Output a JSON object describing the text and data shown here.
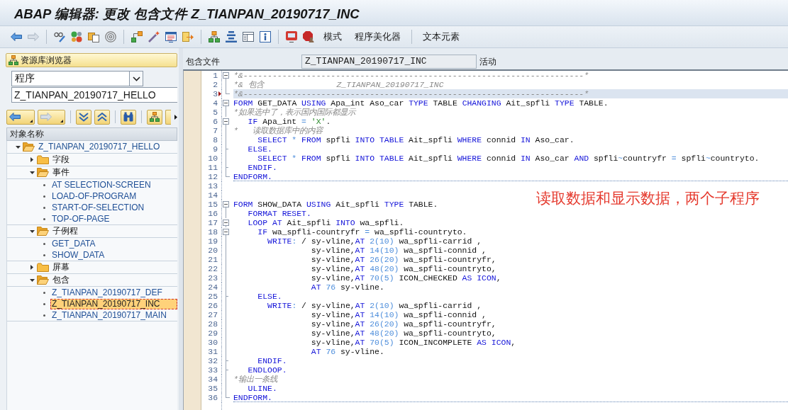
{
  "window": {
    "title": "ABAP 编辑器: 更改 包含文件 Z_TIANPAN_20190717_INC"
  },
  "toolbar": {
    "back_disabled": false,
    "forward_disabled": true,
    "text_button_groups": [
      [
        "模式",
        "程序美化器"
      ],
      [
        "文本元素"
      ]
    ]
  },
  "repository_browser": {
    "title": "资源库浏览器",
    "object_type": "程序",
    "object_name": "Z_TIANPAN_20190717_HELLO",
    "back_disabled": false,
    "forward_disabled": true,
    "tree": {
      "header": "对象名称",
      "items": [
        {
          "label": "Z_TIANPAN_20190717_HELLO",
          "kind": "program",
          "expanded": true,
          "selected": false,
          "children": [
            {
              "label": "字段",
              "kind": "folder",
              "expanded": false,
              "selected": false
            },
            {
              "label": "事件",
              "kind": "folder",
              "expanded": true,
              "selected": false,
              "children": [
                {
                  "label": "AT SELECTION-SCREEN",
                  "kind": "leaf",
                  "selected": false
                },
                {
                  "label": "LOAD-OF-PROGRAM",
                  "kind": "leaf",
                  "selected": false
                },
                {
                  "label": "START-OF-SELECTION",
                  "kind": "leaf",
                  "selected": false
                },
                {
                  "label": "TOP-OF-PAGE",
                  "kind": "leaf",
                  "selected": false
                }
              ]
            },
            {
              "label": "子例程",
              "kind": "folder",
              "expanded": true,
              "selected": false,
              "children": [
                {
                  "label": "GET_DATA",
                  "kind": "leaf",
                  "selected": false
                },
                {
                  "label": "SHOW_DATA",
                  "kind": "leaf",
                  "selected": false
                }
              ]
            },
            {
              "label": "屏幕",
              "kind": "folder",
              "expanded": false,
              "selected": false
            },
            {
              "label": "包含",
              "kind": "folder",
              "expanded": true,
              "selected": false,
              "children": [
                {
                  "label": "Z_TIANPAN_20190717_DEF",
                  "kind": "leaf",
                  "selected": false
                },
                {
                  "label": "Z_TIANPAN_20190717_INC",
                  "kind": "leaf",
                  "selected": true
                },
                {
                  "label": "Z_TIANPAN_20190717_MAIN",
                  "kind": "leaf",
                  "selected": false
                }
              ]
            }
          ]
        }
      ]
    }
  },
  "include_bar": {
    "label": "包含文件",
    "value": "Z_TIANPAN_20190717_INC",
    "status": "活动"
  },
  "code": {
    "lines": [
      {
        "number": "1",
        "kind": "start",
        "current": false,
        "divider_below": false,
        "tokens": [
          {
            "text": "*&----------------------------------------------------------------------*",
            "kind": "comment"
          }
        ]
      },
      {
        "number": "2",
        "kind": "bar",
        "current": false,
        "divider_below": false,
        "tokens": [
          {
            "text": "*& 包含               Z_TIANPAN_20190717_INC",
            "kind": "comment"
          }
        ]
      },
      {
        "number": "3",
        "kind": "end",
        "current": true,
        "divider_below": false,
        "tokens": [
          {
            "text": "*&----------------------------------------------------------------------*",
            "kind": "comment"
          }
        ]
      },
      {
        "number": "4",
        "kind": "start",
        "current": false,
        "divider_below": false,
        "tokens": [
          {
            "text": "FORM",
            "kind": "keyword"
          },
          {
            "text": " GET_DATA ",
            "kind": "text"
          },
          {
            "text": "USING",
            "kind": "keyword"
          },
          {
            "text": " Apa_int Aso_car ",
            "kind": "text"
          },
          {
            "text": "TYPE",
            "kind": "keyword"
          },
          {
            "text": " TABLE ",
            "kind": "text"
          },
          {
            "text": "CHANGING",
            "kind": "keyword"
          },
          {
            "text": " Ait_spfli ",
            "kind": "text"
          },
          {
            "text": "TYPE",
            "kind": "keyword"
          },
          {
            "text": " TABLE.",
            "kind": "text"
          }
        ]
      },
      {
        "number": "5",
        "kind": "bar",
        "current": false,
        "divider_below": false,
        "tokens": [
          {
            "text": "*如果选中了，表示国内国际都显示",
            "kind": "comment"
          }
        ]
      },
      {
        "number": "6",
        "kind": "start",
        "current": false,
        "divider_below": false,
        "tokens": [
          {
            "text": "   IF",
            "kind": "keyword"
          },
          {
            "text": " Apa_int ",
            "kind": "text"
          },
          {
            "text": "=",
            "kind": "operator"
          },
          {
            "text": " 'X'",
            "kind": "string"
          },
          {
            "text": ".",
            "kind": "text"
          }
        ]
      },
      {
        "number": "7",
        "kind": "bar",
        "current": false,
        "divider_below": false,
        "tokens": [
          {
            "text": "*   读取数据库中的内容",
            "kind": "comment"
          }
        ]
      },
      {
        "number": "8",
        "kind": "bar",
        "current": false,
        "divider_below": false,
        "tokens": [
          {
            "text": "     SELECT",
            "kind": "keyword"
          },
          {
            "text": " * ",
            "kind": "operator"
          },
          {
            "text": "FROM",
            "kind": "keyword"
          },
          {
            "text": " spfli ",
            "kind": "text"
          },
          {
            "text": "INTO TABLE",
            "kind": "keyword"
          },
          {
            "text": " Ait_spfli ",
            "kind": "text"
          },
          {
            "text": "WHERE",
            "kind": "keyword"
          },
          {
            "text": " connid ",
            "kind": "text"
          },
          {
            "text": "IN",
            "kind": "keyword"
          },
          {
            "text": " Aso_car.",
            "kind": "text"
          }
        ]
      },
      {
        "number": "9",
        "kind": "branch",
        "current": false,
        "divider_below": false,
        "tokens": [
          {
            "text": "   ELSE.",
            "kind": "keyword"
          }
        ]
      },
      {
        "number": "10",
        "kind": "bar",
        "current": false,
        "divider_below": false,
        "tokens": [
          {
            "text": "     SELECT",
            "kind": "keyword"
          },
          {
            "text": " * ",
            "kind": "operator"
          },
          {
            "text": "FROM",
            "kind": "keyword"
          },
          {
            "text": " spfli ",
            "kind": "text"
          },
          {
            "text": "INTO TABLE",
            "kind": "keyword"
          },
          {
            "text": " Ait_spfli ",
            "kind": "text"
          },
          {
            "text": "WHERE",
            "kind": "keyword"
          },
          {
            "text": " connid ",
            "kind": "text"
          },
          {
            "text": "IN",
            "kind": "keyword"
          },
          {
            "text": " Aso_car ",
            "kind": "text"
          },
          {
            "text": "AND",
            "kind": "keyword"
          },
          {
            "text": " spfli",
            "kind": "text"
          },
          {
            "text": "~",
            "kind": "operator"
          },
          {
            "text": "countryfr ",
            "kind": "text"
          },
          {
            "text": "=",
            "kind": "operator"
          },
          {
            "text": " spfli",
            "kind": "text"
          },
          {
            "text": "~",
            "kind": "operator"
          },
          {
            "text": "countryto.",
            "kind": "text"
          }
        ]
      },
      {
        "number": "11",
        "kind": "branch",
        "current": false,
        "divider_below": false,
        "tokens": [
          {
            "text": "   ENDIF.",
            "kind": "keyword"
          }
        ]
      },
      {
        "number": "12",
        "kind": "end",
        "current": false,
        "divider_below": true,
        "tokens": [
          {
            "text": "ENDFORM.",
            "kind": "keyword"
          }
        ]
      },
      {
        "number": "13",
        "kind": "blank",
        "current": false,
        "divider_below": false
      },
      {
        "number": "14",
        "kind": "blank",
        "current": false,
        "divider_below": false
      },
      {
        "number": "15",
        "kind": "start",
        "current": false,
        "divider_below": false,
        "tokens": [
          {
            "text": "FORM",
            "kind": "keyword"
          },
          {
            "text": " SHOW_DATA ",
            "kind": "text"
          },
          {
            "text": "USING",
            "kind": "keyword"
          },
          {
            "text": " Ait_spfli ",
            "kind": "text"
          },
          {
            "text": "TYPE",
            "kind": "keyword"
          },
          {
            "text": " TABLE.",
            "kind": "text"
          }
        ]
      },
      {
        "number": "16",
        "kind": "bar",
        "current": false,
        "divider_below": false,
        "tokens": [
          {
            "text": "   FORMAT RESET.",
            "kind": "keyword"
          }
        ]
      },
      {
        "number": "17",
        "kind": "start",
        "current": false,
        "divider_below": false,
        "tokens": [
          {
            "text": "   LOOP AT",
            "kind": "keyword"
          },
          {
            "text": " Ait_spfli ",
            "kind": "text"
          },
          {
            "text": "INTO",
            "kind": "keyword"
          },
          {
            "text": " wa_spfli.",
            "kind": "text"
          }
        ]
      },
      {
        "number": "18",
        "kind": "start",
        "current": false,
        "divider_below": false,
        "tokens": [
          {
            "text": "     IF",
            "kind": "keyword"
          },
          {
            "text": " wa_spfli-countryfr ",
            "kind": "text"
          },
          {
            "text": "=",
            "kind": "operator"
          },
          {
            "text": " wa_spfli-countryto.",
            "kind": "text"
          }
        ]
      },
      {
        "number": "19",
        "kind": "bar",
        "current": false,
        "divider_below": false,
        "tokens": [
          {
            "text": "       WRITE",
            "kind": "keyword"
          },
          {
            "text": ":",
            "kind": "operator"
          },
          {
            "text": " / sy-vline,",
            "kind": "text"
          },
          {
            "text": "AT",
            "kind": "keyword"
          },
          {
            "text": " 2(10)",
            "kind": "number"
          },
          {
            "text": " wa_spfli-carrid ,",
            "kind": "text"
          }
        ]
      },
      {
        "number": "20",
        "kind": "bar",
        "current": false,
        "divider_below": false,
        "tokens": [
          {
            "text": "                sy-vline,",
            "kind": "text"
          },
          {
            "text": "AT",
            "kind": "keyword"
          },
          {
            "text": " 14(10)",
            "kind": "number"
          },
          {
            "text": " wa_spfli-connid ,",
            "kind": "text"
          }
        ]
      },
      {
        "number": "21",
        "kind": "bar",
        "current": false,
        "divider_below": false,
        "tokens": [
          {
            "text": "                sy-vline,",
            "kind": "text"
          },
          {
            "text": "AT",
            "kind": "keyword"
          },
          {
            "text": " 26(20)",
            "kind": "number"
          },
          {
            "text": " wa_spfli-countryfr,",
            "kind": "text"
          }
        ]
      },
      {
        "number": "22",
        "kind": "bar",
        "current": false,
        "divider_below": false,
        "tokens": [
          {
            "text": "                sy-vline,",
            "kind": "text"
          },
          {
            "text": "AT",
            "kind": "keyword"
          },
          {
            "text": " 48(20)",
            "kind": "number"
          },
          {
            "text": " wa_spfli-countryto,",
            "kind": "text"
          }
        ]
      },
      {
        "number": "23",
        "kind": "bar",
        "current": false,
        "divider_below": false,
        "tokens": [
          {
            "text": "                sy-vline,",
            "kind": "text"
          },
          {
            "text": "AT",
            "kind": "keyword"
          },
          {
            "text": " 70(5)",
            "kind": "number"
          },
          {
            "text": " ICON_CHECKED ",
            "kind": "text"
          },
          {
            "text": "AS ICON",
            "kind": "keyword"
          },
          {
            "text": ",",
            "kind": "text"
          }
        ]
      },
      {
        "number": "24",
        "kind": "bar",
        "current": false,
        "divider_below": false,
        "tokens": [
          {
            "text": "                AT",
            "kind": "keyword"
          },
          {
            "text": " 76",
            "kind": "number"
          },
          {
            "text": " sy-vline.",
            "kind": "text"
          }
        ]
      },
      {
        "number": "25",
        "kind": "branch",
        "current": false,
        "divider_below": false,
        "tokens": [
          {
            "text": "     ELSE.",
            "kind": "keyword"
          }
        ]
      },
      {
        "number": "26",
        "kind": "bar",
        "current": false,
        "divider_below": false,
        "tokens": [
          {
            "text": "       WRITE",
            "kind": "keyword"
          },
          {
            "text": ":",
            "kind": "operator"
          },
          {
            "text": " / sy-vline,",
            "kind": "text"
          },
          {
            "text": "AT",
            "kind": "keyword"
          },
          {
            "text": " 2(10)",
            "kind": "number"
          },
          {
            "text": " wa_spfli-carrid ,",
            "kind": "text"
          }
        ]
      },
      {
        "number": "27",
        "kind": "bar",
        "current": false,
        "divider_below": false,
        "tokens": [
          {
            "text": "                sy-vline,",
            "kind": "text"
          },
          {
            "text": "AT",
            "kind": "keyword"
          },
          {
            "text": " 14(10)",
            "kind": "number"
          },
          {
            "text": " wa_spfli-connid ,",
            "kind": "text"
          }
        ]
      },
      {
        "number": "28",
        "kind": "bar",
        "current": false,
        "divider_below": false,
        "tokens": [
          {
            "text": "                sy-vline,",
            "kind": "text"
          },
          {
            "text": "AT",
            "kind": "keyword"
          },
          {
            "text": " 26(20)",
            "kind": "number"
          },
          {
            "text": " wa_spfli-countryfr,",
            "kind": "text"
          }
        ]
      },
      {
        "number": "29",
        "kind": "bar",
        "current": false,
        "divider_below": false,
        "tokens": [
          {
            "text": "                sy-vline,",
            "kind": "text"
          },
          {
            "text": "AT",
            "kind": "keyword"
          },
          {
            "text": " 48(20)",
            "kind": "number"
          },
          {
            "text": " wa_spfli-countryto,",
            "kind": "text"
          }
        ]
      },
      {
        "number": "30",
        "kind": "bar",
        "current": false,
        "divider_below": false,
        "tokens": [
          {
            "text": "                sy-vline,",
            "kind": "text"
          },
          {
            "text": "AT",
            "kind": "keyword"
          },
          {
            "text": " 70(5)",
            "kind": "number"
          },
          {
            "text": " ICON_INCOMPLETE ",
            "kind": "text"
          },
          {
            "text": "AS ICON",
            "kind": "keyword"
          },
          {
            "text": ",",
            "kind": "text"
          }
        ]
      },
      {
        "number": "31",
        "kind": "bar",
        "current": false,
        "divider_below": false,
        "tokens": [
          {
            "text": "                AT",
            "kind": "keyword"
          },
          {
            "text": " 76",
            "kind": "number"
          },
          {
            "text": " sy-vline.",
            "kind": "text"
          }
        ]
      },
      {
        "number": "32",
        "kind": "branch",
        "current": false,
        "divider_below": false,
        "tokens": [
          {
            "text": "     ENDIF.",
            "kind": "keyword"
          }
        ]
      },
      {
        "number": "33",
        "kind": "branch",
        "current": false,
        "divider_below": false,
        "tokens": [
          {
            "text": "   ENDLOOP.",
            "kind": "keyword"
          }
        ]
      },
      {
        "number": "34",
        "kind": "bar",
        "current": false,
        "divider_below": false,
        "tokens": [
          {
            "text": "*输出一条线",
            "kind": "comment"
          }
        ]
      },
      {
        "number": "35",
        "kind": "bar",
        "current": false,
        "divider_below": false,
        "tokens": [
          {
            "text": "   ULINE.",
            "kind": "keyword"
          }
        ]
      },
      {
        "number": "36",
        "kind": "end",
        "current": false,
        "divider_below": true,
        "tokens": [
          {
            "text": "ENDFORM.",
            "kind": "keyword"
          }
        ]
      }
    ]
  },
  "annotation": {
    "text": "读取数据和显示数据，两个子程序"
  }
}
